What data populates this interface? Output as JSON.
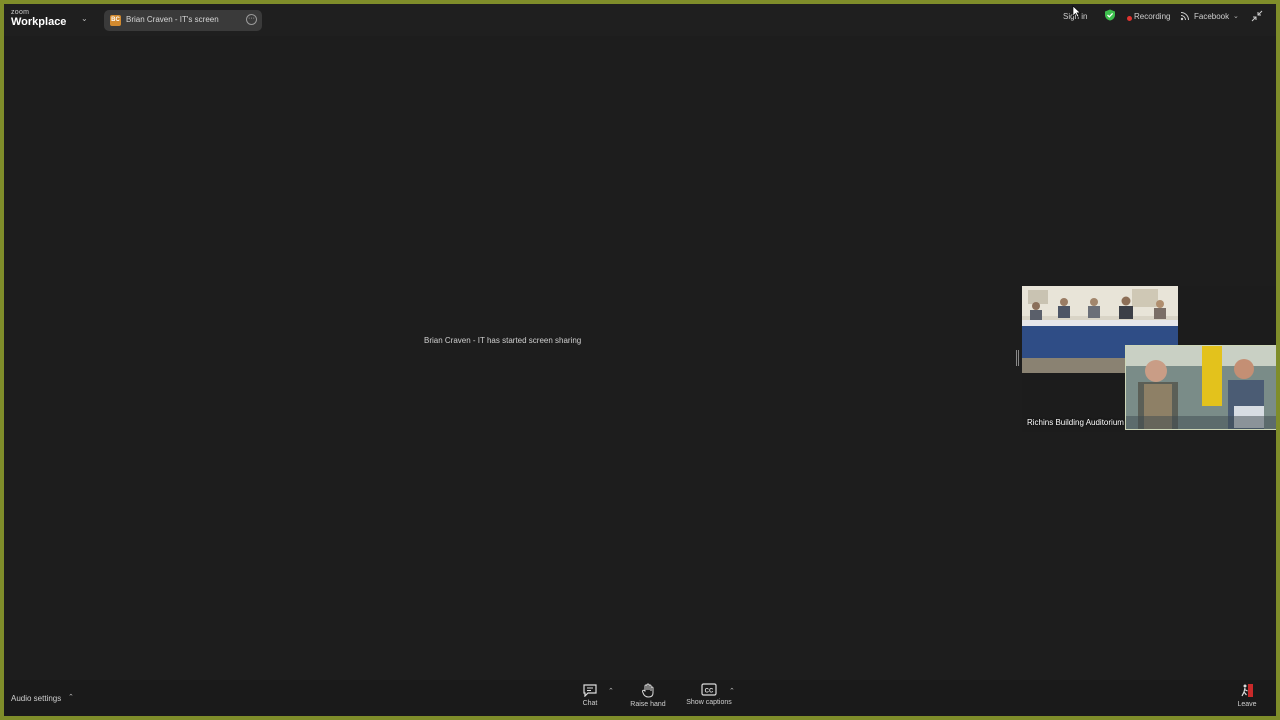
{
  "app": {
    "logo_small": "zoom",
    "logo_big": "Workplace"
  },
  "tab": {
    "avatar_initials": "BC",
    "label": "Brian Craven - IT's screen"
  },
  "topbar": {
    "sign_in": "Sign in",
    "recording": "Recording",
    "facebook": "Facebook"
  },
  "stage": {
    "message": "Brian Craven - IT has started screen sharing"
  },
  "video": {
    "label": "Richins Building Auditorium"
  },
  "toolbar": {
    "audio_settings": "Audio settings",
    "chat": "Chat",
    "raise_hand": "Raise hand",
    "show_captions": "Show captions",
    "leave": "Leave"
  },
  "colors": {
    "frame": "#7f8d2a",
    "record": "#e0332f",
    "shield": "#3dbf4d"
  },
  "icons": [
    "chevron-down-icon",
    "more-icon",
    "shield-check-icon",
    "record-dot-icon",
    "rss-icon",
    "shrink-icon",
    "chat-icon",
    "hand-icon",
    "cc-icon",
    "leave-icon",
    "chevron-up-icon"
  ]
}
